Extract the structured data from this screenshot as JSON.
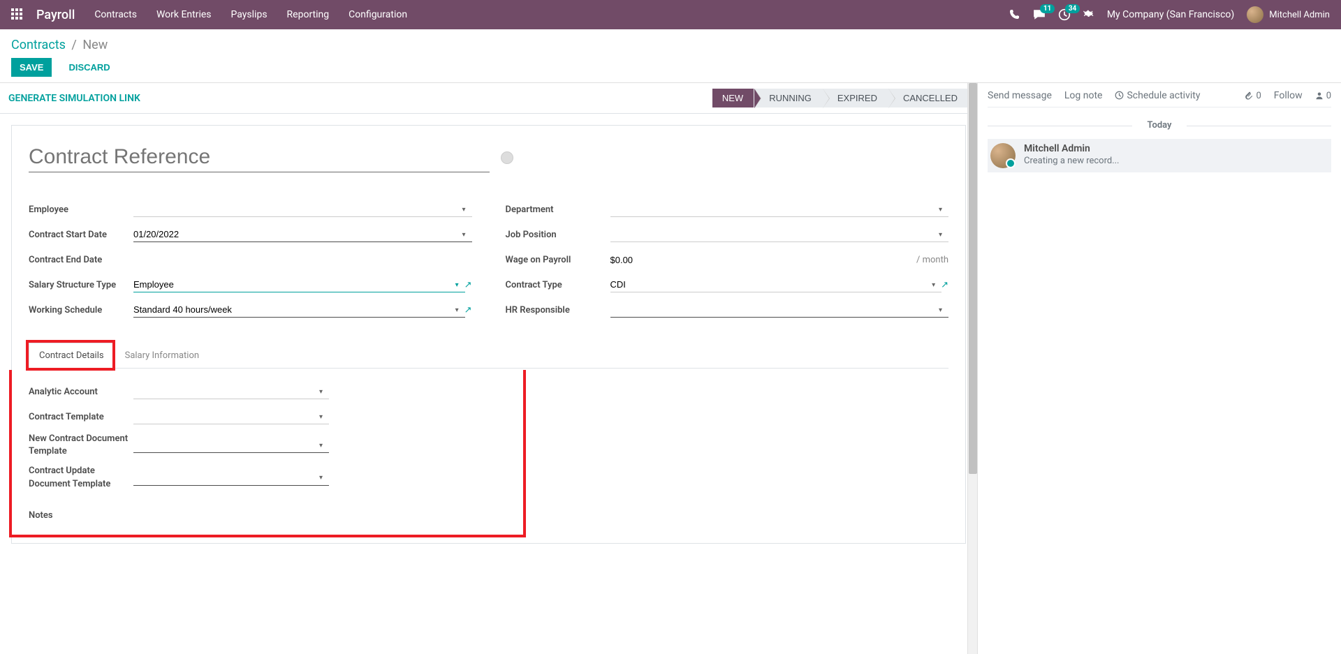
{
  "nav": {
    "brand": "Payroll",
    "menu": [
      "Contracts",
      "Work Entries",
      "Payslips",
      "Reporting",
      "Configuration"
    ],
    "messaging_badge": "11",
    "activity_badge": "34",
    "company": "My Company (San Francisco)",
    "user": "Mitchell Admin"
  },
  "breadcrumb": {
    "root": "Contracts",
    "current": "New"
  },
  "buttons": {
    "save": "SAVE",
    "discard": "DISCARD",
    "generate_link": "GENERATE SIMULATION LINK"
  },
  "status": {
    "stages": [
      "NEW",
      "RUNNING",
      "EXPIRED",
      "CANCELLED"
    ],
    "active_index": 0
  },
  "form": {
    "title_placeholder": "Contract Reference",
    "left": {
      "employee_label": "Employee",
      "employee_value": "",
      "start_date_label": "Contract Start Date",
      "start_date_value": "01/20/2022",
      "end_date_label": "Contract End Date",
      "end_date_value": "",
      "salary_type_label": "Salary Structure Type",
      "salary_type_value": "Employee",
      "schedule_label": "Working Schedule",
      "schedule_value": "Standard 40 hours/week"
    },
    "right": {
      "department_label": "Department",
      "department_value": "",
      "position_label": "Job Position",
      "position_value": "",
      "wage_label": "Wage on Payroll",
      "wage_value": "$0.00",
      "wage_suffix": "/ month",
      "contract_type_label": "Contract Type",
      "contract_type_value": "CDI",
      "hr_label": "HR Responsible",
      "hr_value": ""
    },
    "tabs": {
      "details": "Contract Details",
      "salary": "Salary Information"
    },
    "details": {
      "analytic_label": "Analytic Account",
      "analytic_value": "",
      "template_label": "Contract Template",
      "template_value": "",
      "new_doc_label": "New Contract Document Template",
      "new_doc_value": "",
      "update_doc_label": "Contract Update Document Template",
      "update_doc_value": "",
      "notes_label": "Notes"
    }
  },
  "chatter": {
    "send_message": "Send message",
    "log_note": "Log note",
    "schedule_activity": "Schedule activity",
    "attach_count": "0",
    "follow_label": "Follow",
    "follower_count": "0",
    "today_label": "Today",
    "msg_author": "Mitchell Admin",
    "msg_text": "Creating a new record..."
  }
}
